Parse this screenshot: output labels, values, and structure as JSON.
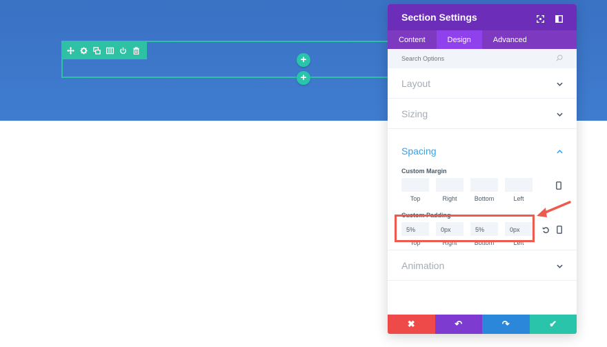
{
  "colors": {
    "hero": "#3f7cd0",
    "row_teal": "#2ec1a3",
    "panel_header": "#6c2eb9",
    "panel_tabs": "#7d3ac1",
    "active_tab": "#8f42ec",
    "accent_blue": "#2ea3f2",
    "footer_cancel": "#ef4a4a",
    "footer_undo": "#7e3bd0",
    "footer_redo": "#2b87da",
    "footer_save": "#29c4a9",
    "annotation": "#ef5a4f"
  },
  "row_toolbar": {
    "icons": [
      "move-icon",
      "gear-icon",
      "duplicate-icon",
      "columns-icon",
      "power-icon",
      "trash-icon"
    ]
  },
  "add_buttons": {
    "label": "+"
  },
  "panel": {
    "title": "Section Settings",
    "header_icons": [
      "fullscreen-icon",
      "sidebar-icon"
    ],
    "tabs": [
      {
        "label": "Content",
        "active": false
      },
      {
        "label": "Design",
        "active": true
      },
      {
        "label": "Advanced",
        "active": false
      }
    ],
    "search_placeholder": "Search Options",
    "sections": {
      "layout": "Layout",
      "sizing": "Sizing",
      "spacing": "Spacing",
      "animation": "Animation"
    },
    "custom_margin": {
      "label": "Custom Margin",
      "fields": [
        {
          "label": "Top",
          "value": ""
        },
        {
          "label": "Right",
          "value": ""
        },
        {
          "label": "Bottom",
          "value": ""
        },
        {
          "label": "Left",
          "value": ""
        }
      ]
    },
    "custom_padding": {
      "label": "Custom Padding",
      "fields": [
        {
          "label": "Top",
          "value": "5%"
        },
        {
          "label": "Right",
          "value": "0px"
        },
        {
          "label": "Bottom",
          "value": "5%"
        },
        {
          "label": "Left",
          "value": "0px"
        }
      ]
    },
    "footer": {
      "cancel": "✖",
      "undo": "↶",
      "redo": "↷",
      "save": "✔"
    }
  }
}
